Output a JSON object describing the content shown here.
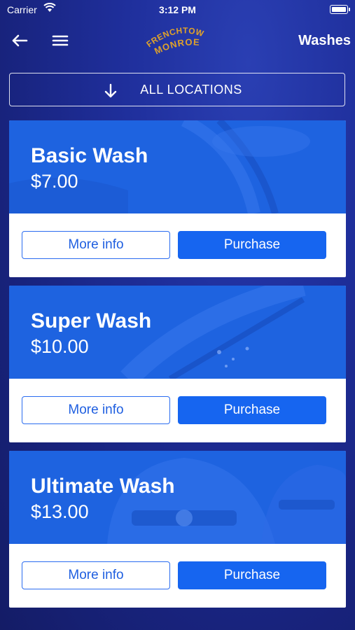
{
  "status_bar": {
    "carrier": "Carrier",
    "time": "3:12 PM"
  },
  "nav": {
    "title": "Washes",
    "logo_text_top": "FRENCHTOWN",
    "logo_text_bottom": "MONROE"
  },
  "location_filter": {
    "label": "ALL LOCATIONS"
  },
  "washes": [
    {
      "name": "Basic Wash",
      "price": "$7.00",
      "more_label": "More info",
      "buy_label": "Purchase"
    },
    {
      "name": "Super Wash",
      "price": "$10.00",
      "more_label": "More info",
      "buy_label": "Purchase"
    },
    {
      "name": "Ultimate Wash",
      "price": "$13.00",
      "more_label": "More info",
      "buy_label": "Purchase"
    }
  ],
  "colors": {
    "background": "#1a2788",
    "banner": "#1e63e0",
    "button": "#1665f0",
    "logo": "#e0a22a"
  }
}
